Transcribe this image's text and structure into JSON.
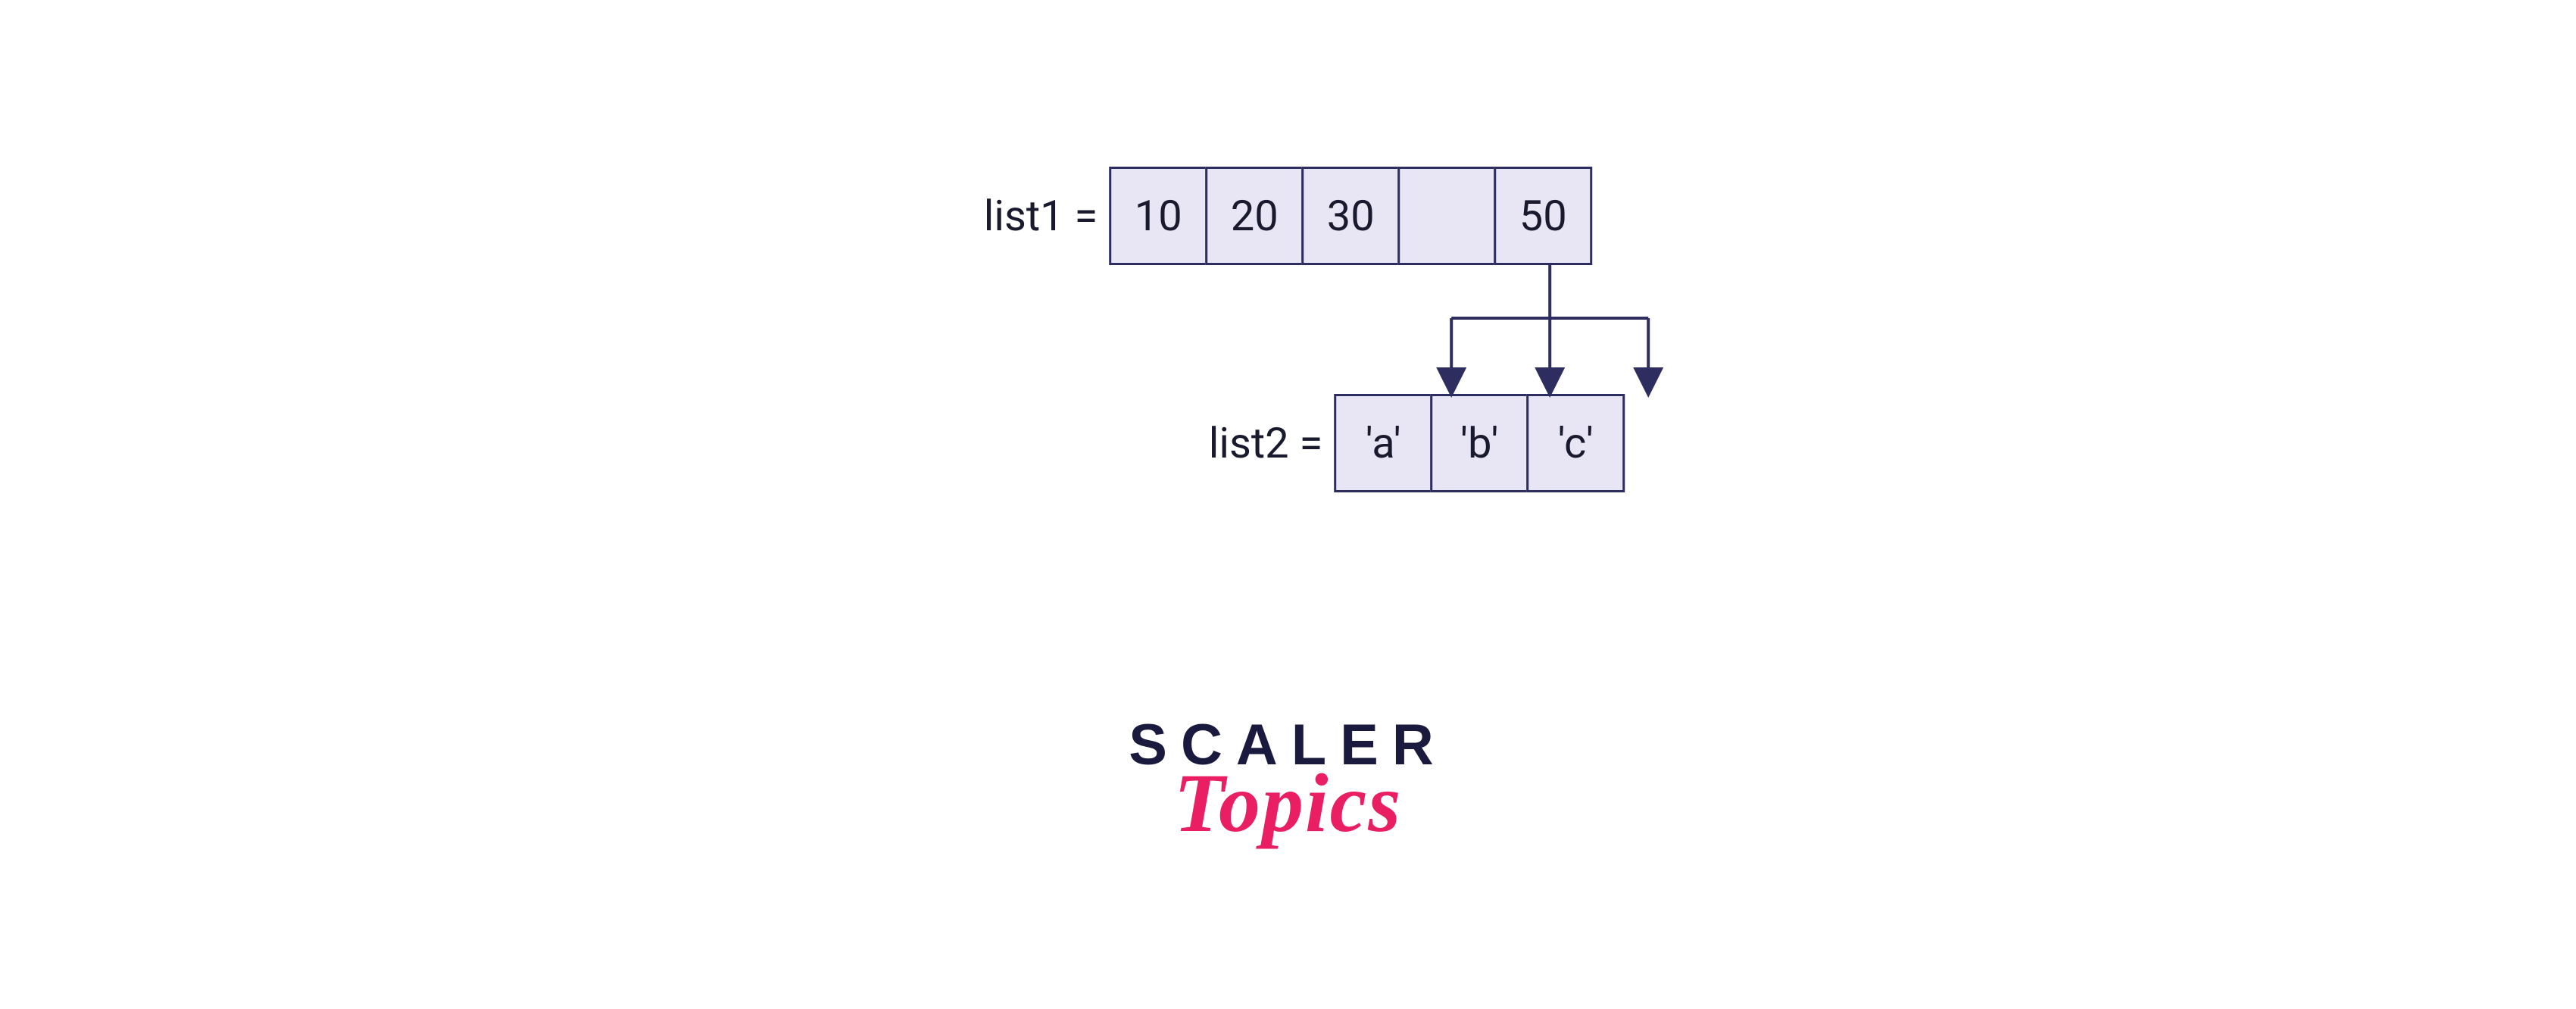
{
  "diagram": {
    "list1": {
      "label": "list1 =",
      "cells": [
        "10",
        "20",
        "30",
        "",
        "50"
      ]
    },
    "list2": {
      "label": "list2 =",
      "cells": [
        "'a'",
        "'b'",
        "'c'"
      ]
    }
  },
  "logo": {
    "line1": "SCALER",
    "line2": "Topics"
  },
  "colors": {
    "cell_bg": "#e8e6f5",
    "cell_border": "#2d2d5f",
    "text": "#1a1a2e",
    "logo_dark": "#1a1a3e",
    "logo_pink": "#e91e63"
  }
}
